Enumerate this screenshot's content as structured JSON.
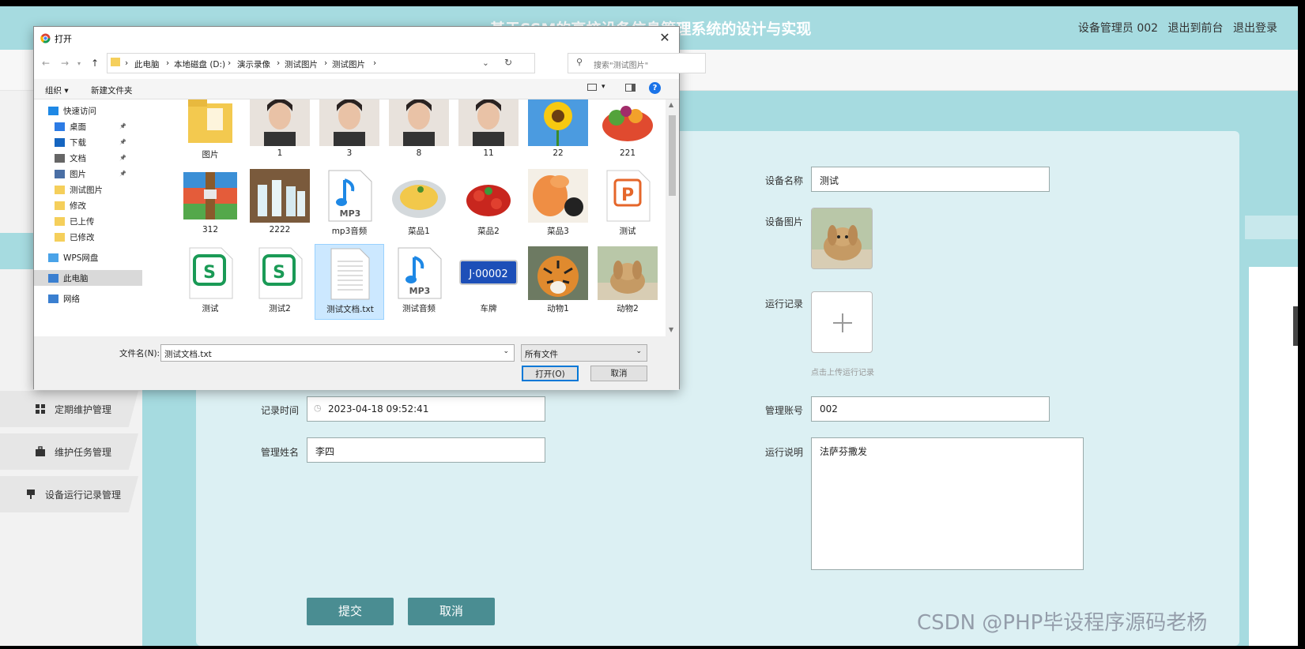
{
  "app": {
    "title": "基于SSM的高校设备信息管理系统的设计与实现",
    "user_label": "设备管理员 002",
    "back_link": "退出到前台",
    "logout_link": "退出登录"
  },
  "sidebar": {
    "items": [
      {
        "label": "定期维护管理",
        "icon": "grid-icon"
      },
      {
        "label": "维护任务管理",
        "icon": "briefcase-icon"
      },
      {
        "label": "设备运行记录管理",
        "icon": "server-icon"
      }
    ]
  },
  "form": {
    "device_name_label": "设备名称",
    "device_name_value": "测试",
    "device_image_label": "设备图片",
    "run_record_label": "运行记录",
    "upload_hint": "点击上传运行记录",
    "record_time_label": "记录时间",
    "record_time_value": "2023-04-18 09:52:41",
    "manager_account_label": "管理账号",
    "manager_account_value": "002",
    "manager_name_label": "管理姓名",
    "manager_name_value": "李四",
    "run_desc_label": "运行说明",
    "run_desc_value": "法萨芬撒发",
    "submit_label": "提交",
    "cancel_label": "取消"
  },
  "dialog": {
    "title": "打开",
    "breadcrumb": [
      "此电脑",
      "本地磁盘 (D:)",
      "演示录像",
      "测试图片",
      "测试图片"
    ],
    "search_placeholder": "搜索\"测试图片\"",
    "organize_label": "组织 ▾",
    "new_folder_label": "新建文件夹",
    "tree": [
      {
        "label": "快速访问",
        "icon": "star-icon"
      },
      {
        "label": "桌面",
        "icon": "desktop-icon"
      },
      {
        "label": "下载",
        "icon": "download-icon"
      },
      {
        "label": "文档",
        "icon": "document-icon"
      },
      {
        "label": "图片",
        "icon": "picture-icon"
      },
      {
        "label": "测试图片",
        "icon": "folder-icon"
      },
      {
        "label": "修改",
        "icon": "folder-icon"
      },
      {
        "label": "已上传",
        "icon": "folder-icon"
      },
      {
        "label": "已修改",
        "icon": "folder-icon"
      },
      {
        "label": "WPS网盘",
        "icon": "cloud-icon"
      },
      {
        "label": "此电脑",
        "icon": "computer-icon"
      },
      {
        "label": "网络",
        "icon": "network-icon"
      }
    ],
    "files": [
      {
        "name": "图片",
        "kind": "folder"
      },
      {
        "name": "1",
        "kind": "photo"
      },
      {
        "name": "3",
        "kind": "photo"
      },
      {
        "name": "8",
        "kind": "photo"
      },
      {
        "name": "11",
        "kind": "photo"
      },
      {
        "name": "22",
        "kind": "sunflower"
      },
      {
        "name": "221",
        "kind": "vegetables"
      },
      {
        "name": "312",
        "kind": "archive"
      },
      {
        "name": "2222",
        "kind": "bottles"
      },
      {
        "name": "mp3音频",
        "kind": "mp3"
      },
      {
        "name": "菜品1",
        "kind": "dish"
      },
      {
        "name": "菜品2",
        "kind": "crayfish"
      },
      {
        "name": "菜品3",
        "kind": "shrimp"
      },
      {
        "name": "测试",
        "kind": "ppt"
      },
      {
        "name": "测试",
        "kind": "wps-sheet"
      },
      {
        "name": "测试2",
        "kind": "wps-sheet"
      },
      {
        "name": "测试文档.txt",
        "kind": "txt",
        "selected": true
      },
      {
        "name": "测试音频",
        "kind": "mp3"
      },
      {
        "name": "车牌",
        "kind": "plate"
      },
      {
        "name": "动物1",
        "kind": "tiger"
      },
      {
        "name": "动物2",
        "kind": "rabbit"
      }
    ],
    "plate_text": "J·00002",
    "mp3_text": "MP3",
    "filename_label": "文件名(N):",
    "filename_value": "测试文档.txt",
    "filetype_value": "所有文件",
    "open_label": "打开(O)",
    "cancel_label": "取消"
  },
  "watermark": "CSDN @PHP毕设程序源码老杨"
}
